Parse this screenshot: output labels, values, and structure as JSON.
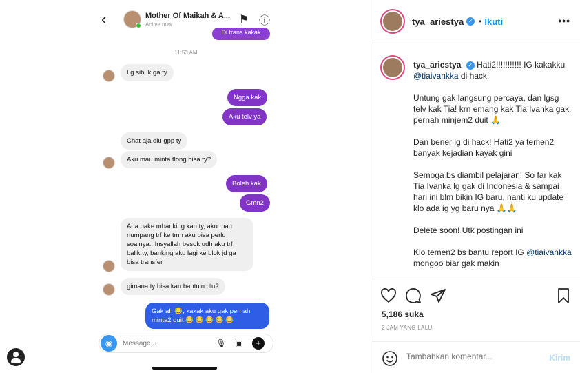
{
  "chat": {
    "contact_name": "Mother Of Maikah & A...",
    "contact_status": "Active now",
    "top_bubble_text": "Di trans kakak",
    "time": "11:53 AM",
    "messages": [
      {
        "dir": "in",
        "text": "Lg sibuk ga ty"
      },
      {
        "dir": "out",
        "text": "Ngga kak"
      },
      {
        "dir": "out",
        "text": "Aku telv ya"
      },
      {
        "dir": "in",
        "text": "Chat aja dlu gpp ty"
      },
      {
        "dir": "in",
        "text": "Aku mau minta tlong bisa ty?"
      },
      {
        "dir": "out",
        "text": "Boleh kak"
      },
      {
        "dir": "out",
        "text": "Gmn2"
      },
      {
        "dir": "in",
        "text": "Ada pake mbanking kan ty, aku mau numpang trf ke tmn aku bisa perlu soalnya.. Insyallah besok udh aku trf balik ty, banking aku lagi ke blok jd ga bisa transfer"
      },
      {
        "dir": "in",
        "text": "gimana ty bisa kan bantuin dlu?"
      },
      {
        "dir": "out",
        "text": "Gak ah 😂, kakak aku gak pernah minta2 duit 😂 😂 😂 😂 😂"
      }
    ],
    "input_placeholder": "Message...",
    "colors": {
      "purple": "#8134c6",
      "blue": "#2f5de6"
    }
  },
  "post": {
    "username": "tya_ariestya",
    "follow_label": "Ikuti",
    "more_label": "•••",
    "caption": {
      "p1_start": "Hati2!!!!!!!!!!! IG kakakku",
      "p1_mention": "@tiaivankka",
      "p1_end": "di hack!",
      "p2": "Untung gak langsung percaya, dan lgsg telv kak Tia! krn emang kak Tia Ivanka gak pernah minjem2 duit 🙏",
      "p3": "Dan bener ig di hack! Hati2 ya temen2 banyak kejadian kayak gini",
      "p4": "Semoga bs diambil pelajaran! So far kak Tia Ivanka lg gak di Indonesia & sampai hari ini blm bikin IG baru, nanti ku update klo ada ig yg baru nya 🙏🙏",
      "p5": "Delete soon! Utk postingan ini",
      "p6_start": "Klo temen2 bs bantu report IG",
      "p6_mention": "@tiaivankka",
      "p6_end": "mongoo biar gak makin"
    },
    "likes": "5,186 suka",
    "time_ago": "2 JAM YANG LALU",
    "comment_placeholder": "Tambahkan komentar...",
    "send_label": "Kirim"
  }
}
